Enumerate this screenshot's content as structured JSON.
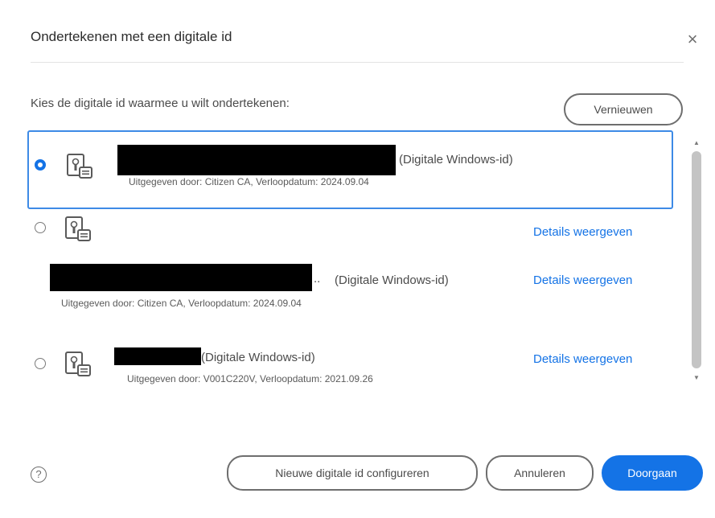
{
  "dialog": {
    "title": "Ondertekenen met een digitale id",
    "close_glyph": "×",
    "prompt": "Kies de digitale id waarmee u wilt ondertekenen:",
    "refresh_label": "Vernieuwen"
  },
  "ids": [
    {
      "selected": true,
      "type_label": "(Digitale Windows-id)",
      "issuer_line": "Uitgegeven door: Citizen CA, Verloopdatum: 2024.09.04",
      "details_label": ""
    },
    {
      "selected": false,
      "type_label": "(Digitale Windows-id)",
      "issuer_line": "Uitgegeven door: Citizen CA, Verloopdatum: 2024.09.04",
      "truncation": "..",
      "details_label_top": "Details weergeven",
      "details_label": "Details weergeven"
    },
    {
      "selected": false,
      "type_label": "(Digitale Windows-id)",
      "issuer_line": "Uitgegeven door: V001C220V, Verloopdatum: 2021.09.26",
      "details_label": "Details weergeven"
    }
  ],
  "footer": {
    "help_glyph": "?",
    "configure_label": "Nieuwe digitale id configureren",
    "cancel_label": "Annuleren",
    "continue_label": "Doorgaan"
  },
  "colors": {
    "accent": "#1473e6",
    "selection_border": "#3d8ae6",
    "redaction": "#000000"
  },
  "icons": {
    "close": "close-icon",
    "certificate": "certificate-id-icon",
    "help": "help-icon",
    "scroll_up": "scroll-up-icon",
    "scroll_down": "scroll-down-icon"
  }
}
